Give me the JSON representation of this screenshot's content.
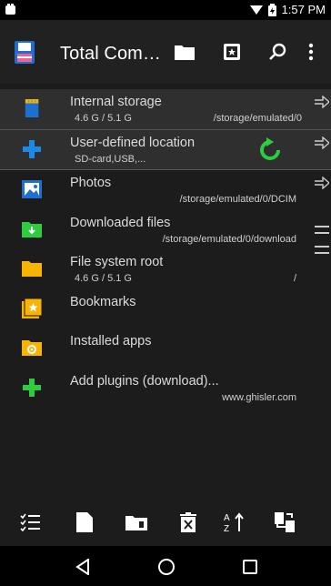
{
  "status": {
    "time": "1:57 PM"
  },
  "appbar": {
    "title": "Total Com…"
  },
  "items": [
    {
      "title": "Internal storage",
      "sub": "4.6 G / 5.1 G",
      "path": "/storage/emulated/0"
    },
    {
      "title": "User-defined location",
      "sub": "SD-card,USB,...",
      "path": ""
    },
    {
      "title": "Photos",
      "sub": "",
      "path": "/storage/emulated/0/DCIM"
    },
    {
      "title": "Downloaded files",
      "sub": "",
      "path": "/storage/emulated/0/download"
    },
    {
      "title": "File system root",
      "sub": "4.6 G / 5.1 G",
      "path": "/"
    },
    {
      "title": "Bookmarks",
      "sub": "",
      "path": ""
    },
    {
      "title": "Installed apps",
      "sub": "",
      "path": ""
    },
    {
      "title": "Add plugins (download)...",
      "sub": "",
      "path": "www.ghisler.com"
    }
  ],
  "colors": {
    "folder": "#f8b400",
    "green": "#2ecc40",
    "blue": "#1e88e5",
    "bg": "#1c1c1c"
  }
}
